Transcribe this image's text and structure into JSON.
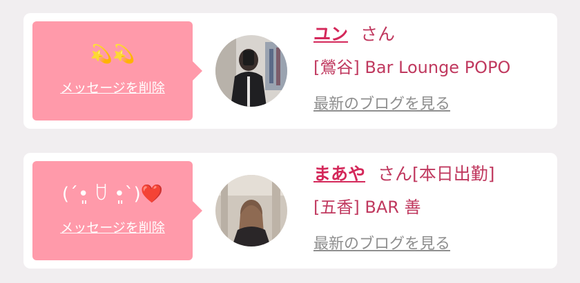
{
  "cards": [
    {
      "message": "💫💫",
      "delete_label": "メッセージを削除",
      "avatar_icon": "profile-photo",
      "name": "ユン",
      "honorific": "さん",
      "shop": "[鶯谷] Bar Lounge POPO",
      "blog_link": "最新のブログを見る"
    },
    {
      "message_text": "(ˊ•͈ ꇴ •͈ˋ)",
      "message_heart": "❤️",
      "delete_label": "メッセージを削除",
      "avatar_icon": "profile-photo",
      "name": "まあや",
      "honorific": "さん[本日出勤]",
      "shop": "[五香] BAR 善",
      "blog_link": "最新のブログを見る"
    }
  ],
  "colors": {
    "bubble": "#ff9aaa",
    "name": "#d4285a",
    "text_accent": "#c0395f",
    "link_gray": "#8e8e8e",
    "background": "#f1eef0"
  }
}
